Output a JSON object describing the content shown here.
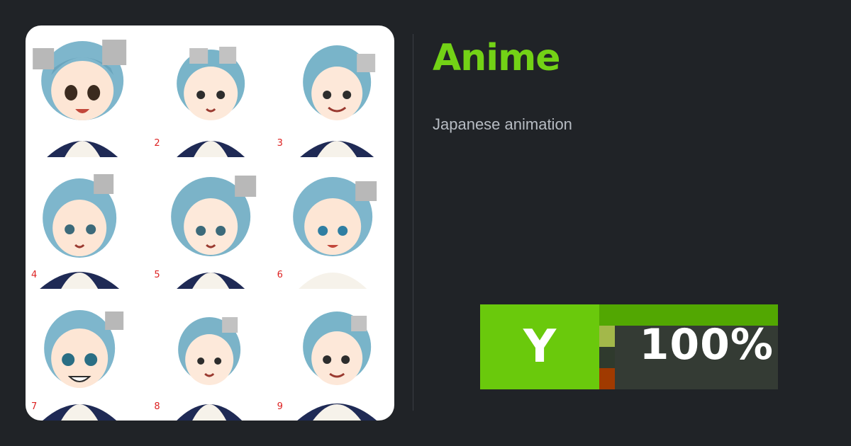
{
  "topic": {
    "title": "Anime",
    "description": "Japanese animation"
  },
  "image_grid": {
    "numbers": [
      "",
      "2",
      "3",
      "4",
      "5",
      "6",
      "7",
      "8",
      "9"
    ]
  },
  "badge": {
    "letter": "Y",
    "percent": "100%",
    "fill_fraction": 1.0
  },
  "colors": {
    "accent": "#73d216",
    "background": "#202327",
    "badge_green": "#6ac90c"
  }
}
